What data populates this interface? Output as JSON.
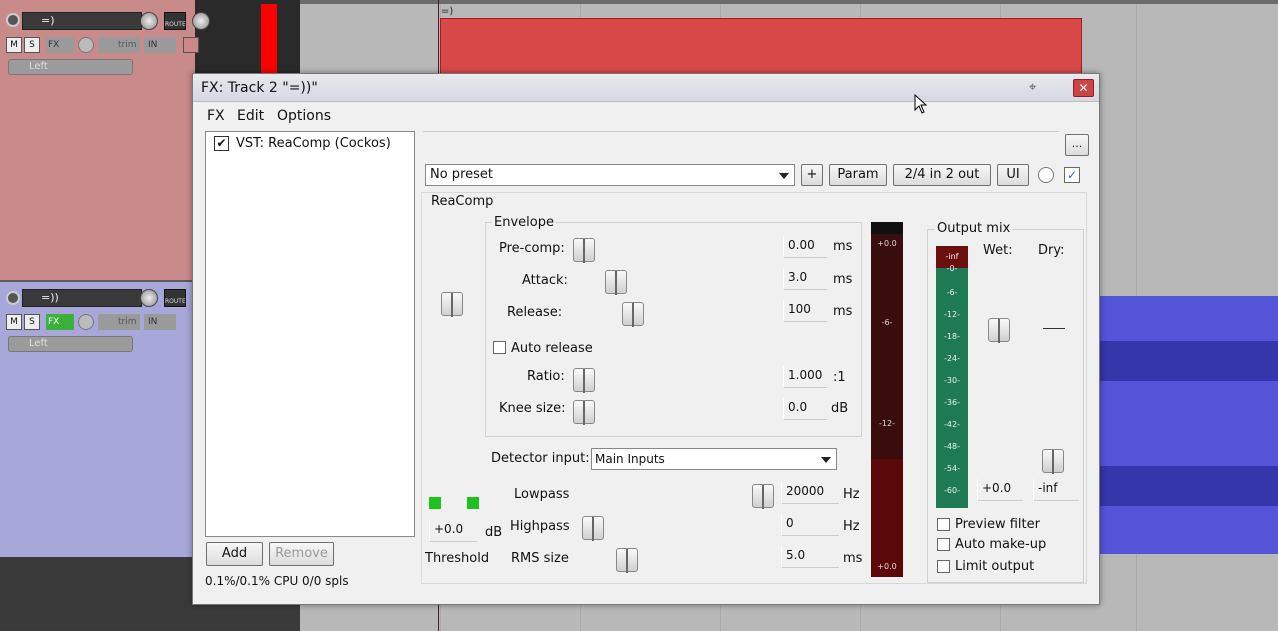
{
  "tracks": [
    {
      "name": "=)",
      "fx_label": "FX",
      "trim_label": "trim",
      "input_label": "IN",
      "channel": "Left",
      "mute": "M",
      "solo": "S",
      "route": "ROUTE"
    },
    {
      "name": "=))",
      "fx_label": "FX",
      "trim_label": "trim",
      "input_label": "IN",
      "channel": "Left",
      "mute": "M",
      "solo": "S",
      "route": "ROUTE"
    }
  ],
  "item_label": "=)",
  "window": {
    "title": "FX: Track 2 \"=))\"",
    "close": "✕",
    "pin": "📌"
  },
  "menu": [
    "FX",
    "Edit",
    "Options"
  ],
  "fx_chain": {
    "items": [
      {
        "label": "VST: ReaComp (Cockos)",
        "enabled": true
      }
    ],
    "add": "Add",
    "remove": "Remove",
    "cpu": "0.1%/0.1% CPU 0/0 spls"
  },
  "toolbar": {
    "more": "...",
    "preset": "No preset",
    "plus": "+",
    "param": "Param",
    "io": "2/4 in 2 out",
    "ui": "UI"
  },
  "plugin": {
    "name": "ReaComp",
    "envelope_title": "Envelope",
    "precomp": {
      "label": "Pre-comp:",
      "value": "0.00",
      "unit": "ms"
    },
    "attack": {
      "label": "Attack:",
      "value": "3.0",
      "unit": "ms"
    },
    "release": {
      "label": "Release:",
      "value": "100",
      "unit": "ms"
    },
    "auto_release": "Auto release",
    "ratio": {
      "label": "Ratio:",
      "value": "1.000",
      "unit": ":1"
    },
    "knee": {
      "label": "Knee size:",
      "value": "0.0",
      "unit": "dB"
    },
    "detector": {
      "label": "Detector input:",
      "value": "Main Inputs"
    },
    "lowpass": {
      "label": "Lowpass",
      "value": "20000",
      "unit": "Hz"
    },
    "highpass": {
      "label": "Highpass",
      "value": "0",
      "unit": "Hz"
    },
    "rms": {
      "label": "RMS size",
      "value": "5.0",
      "unit": "ms"
    },
    "threshold": {
      "label": "Threshold",
      "value": "+0.0",
      "unit": "dB"
    },
    "gr_meter": [
      "+0.0",
      "-6-",
      "-12-",
      "+0.0"
    ],
    "output": {
      "title": "Output mix",
      "wet": "Wet:",
      "dry": "Dry:",
      "wet_value": "+0.0",
      "dry_value": "-inf",
      "meter_top": "-inf",
      "meter_scale": [
        "-0-",
        "-6-",
        "-12-",
        "-18-",
        "-24-",
        "-30-",
        "-36-",
        "-42-",
        "-48-",
        "-54-",
        "-60-"
      ]
    },
    "preview_filter": "Preview filter",
    "auto_makeup": "Auto make-up",
    "limit_output": "Limit output"
  }
}
